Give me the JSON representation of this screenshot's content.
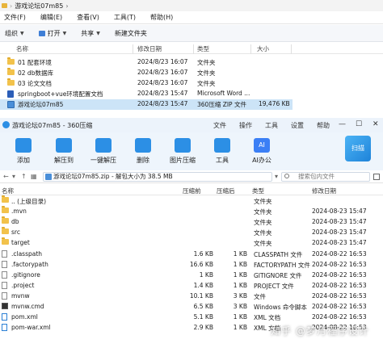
{
  "explorer": {
    "title": "游戏论坛07m85",
    "menu": [
      "文件(F)",
      "编辑(E)",
      "查看(V)",
      "工具(T)",
      "帮助(H)"
    ],
    "toolbar": {
      "organize": "组织",
      "open": "打开",
      "share": "共享",
      "new_folder": "新建文件夹"
    },
    "columns": {
      "name": "名称",
      "modified": "修改日期",
      "type": "类型",
      "size": "大小"
    },
    "rows": [
      {
        "name": "01 配套环境",
        "modified": "2024/8/23 16:07",
        "type": "文件夹",
        "size": "",
        "icon": "folder"
      },
      {
        "name": "02 db数据库",
        "modified": "2024/8/23 16:07",
        "type": "文件夹",
        "size": "",
        "icon": "folder"
      },
      {
        "name": "03 论文文档",
        "modified": "2024/8/23 16:07",
        "type": "文件夹",
        "size": "",
        "icon": "folder"
      },
      {
        "name": "springboot+vue环境配置文档",
        "modified": "2024/8/23 15:47",
        "type": "Microsoft Word ...",
        "size": "",
        "icon": "word"
      },
      {
        "name": "游戏论坛07m85",
        "modified": "2024/8/23 15:47",
        "type": "360压缩 ZIP 文件",
        "size": "19,476 KB",
        "icon": "zip"
      }
    ]
  },
  "zip": {
    "title": "游戏论坛07m85 - 360压缩",
    "menu": [
      "文件",
      "操作",
      "工具",
      "设置",
      "帮助"
    ],
    "window_buttons": [
      "—",
      "☐",
      "✕"
    ],
    "toolbar": [
      {
        "label": "添加",
        "icon": "add-icon",
        "color": "#2c8fe5"
      },
      {
        "label": "解压到",
        "icon": "extract-to-icon",
        "color": "#2c8fe5"
      },
      {
        "label": "一键解压",
        "icon": "one-click-extract-icon",
        "color": "#2c8fe5"
      },
      {
        "label": "删除",
        "icon": "delete-icon",
        "color": "#2c8fe5"
      },
      {
        "label": "图片压缩",
        "icon": "image-compress-icon",
        "color": "#2c8fe5"
      },
      {
        "label": "工具",
        "icon": "tools-icon",
        "color": "#2c8fe5"
      },
      {
        "label": "AI办公",
        "icon": "ai-office-icon",
        "color": "#3b7ff5"
      }
    ],
    "scan_label": "扫描",
    "address": "游戏论坛07m85.zip - 解包大小为 38.5 MB",
    "search_placeholder": "搜索包内文件",
    "columns": {
      "name": "名称",
      "compressed": "压缩前",
      "size": "压缩后",
      "type": "类型",
      "modified": "修改日期"
    },
    "rows": [
      {
        "name": ".. (上级目录)",
        "compressed": "",
        "size": "",
        "type": "文件夹",
        "modified": "",
        "icon": "folder"
      },
      {
        "name": ".mvn",
        "compressed": "",
        "size": "",
        "type": "文件夹",
        "modified": "2024-08-23 15:47",
        "icon": "folder"
      },
      {
        "name": "db",
        "compressed": "",
        "size": "",
        "type": "文件夹",
        "modified": "2024-08-23 15:47",
        "icon": "folder"
      },
      {
        "name": "src",
        "compressed": "",
        "size": "",
        "type": "文件夹",
        "modified": "2024-08-23 15:47",
        "icon": "folder"
      },
      {
        "name": "target",
        "compressed": "",
        "size": "",
        "type": "文件夹",
        "modified": "2024-08-23 15:47",
        "icon": "folder"
      },
      {
        "name": ".classpath",
        "compressed": "1.6 KB",
        "size": "1 KB",
        "type": "CLASSPATH 文件",
        "modified": "2024-08-22 16:53",
        "icon": "file"
      },
      {
        "name": ".factorypath",
        "compressed": "16.6 KB",
        "size": "1 KB",
        "type": "FACTORYPATH 文件",
        "modified": "2024-08-22 16:53",
        "icon": "file"
      },
      {
        "name": ".gitignore",
        "compressed": "1 KB",
        "size": "1 KB",
        "type": "GITIGNORE 文件",
        "modified": "2024-08-22 16:53",
        "icon": "file"
      },
      {
        "name": ".project",
        "compressed": "1.4 KB",
        "size": "1 KB",
        "type": "PROJECT 文件",
        "modified": "2024-08-22 16:53",
        "icon": "file"
      },
      {
        "name": "mvnw",
        "compressed": "10.1 KB",
        "size": "3 KB",
        "type": "文件",
        "modified": "2024-08-22 16:53",
        "icon": "file"
      },
      {
        "name": "mvnw.cmd",
        "compressed": "6.5 KB",
        "size": "3 KB",
        "type": "Windows 命令脚本",
        "modified": "2024-08-22 16:53",
        "icon": "cmd"
      },
      {
        "name": "pom.xml",
        "compressed": "5.1 KB",
        "size": "1 KB",
        "type": "XML 文档",
        "modified": "2024-08-22 16:53",
        "icon": "xml"
      },
      {
        "name": "pom-war.xml",
        "compressed": "2.9 KB",
        "size": "1 KB",
        "type": "XML 文档",
        "modified": "2024-08-22 16:53",
        "icon": "xml"
      }
    ]
  },
  "watermark": "知乎 @梦月程序设计"
}
